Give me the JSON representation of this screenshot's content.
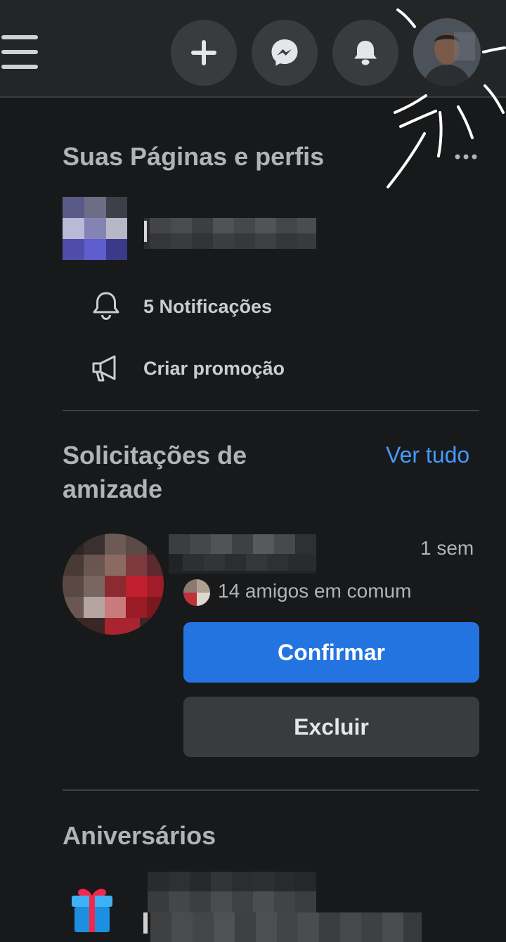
{
  "pages_section": {
    "title": "Suas Páginas e perfis",
    "notifications_label": "5 Notificações",
    "promotion_label": "Criar promoção"
  },
  "friend_requests": {
    "title_line1": "Solicitações de",
    "title_line2": "amizade",
    "see_all": "Ver tudo",
    "request": {
      "time": "1 sem",
      "mutual_friends": "14 amigos em comum",
      "confirm_label": "Confirmar",
      "delete_label": "Excluir"
    }
  },
  "birthdays": {
    "title": "Aniversários"
  },
  "icons": {
    "menu": "hamburger-menu-icon",
    "create": "plus-icon",
    "messenger": "messenger-icon",
    "notifications": "bell-icon",
    "more": "more-dots-icon",
    "bell_row": "bell-outline-icon",
    "megaphone": "megaphone-icon",
    "gift": "gift-icon"
  },
  "colors": {
    "background": "#18191a",
    "topbar": "#242526",
    "primary_button": "#2374e1",
    "link": "#4599ff"
  }
}
